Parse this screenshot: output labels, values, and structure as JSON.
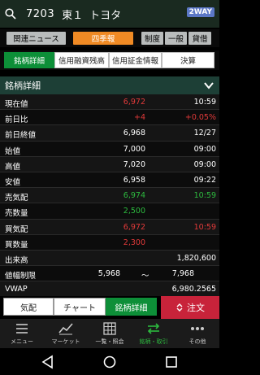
{
  "header": {
    "code": "7203",
    "market": "東１",
    "name": "トヨタ",
    "badge": "2WAY"
  },
  "top_buttons": {
    "news": "関連ニュース",
    "shikiho": "四季報",
    "seido": "制度",
    "ippan": "一般",
    "kashikabu": "貸借"
  },
  "tabs": {
    "detail": "銘柄詳細",
    "margin_balance": "信用融資残高",
    "margin_info": "信用証金情報",
    "settlement": "決算"
  },
  "section": {
    "title": "銘柄詳細"
  },
  "rows": [
    {
      "label": "現在値",
      "value": "6,972",
      "time": "10:59"
    },
    {
      "label": "前日比",
      "value": "+4",
      "time": "+0.05%"
    },
    {
      "label": "前日終値",
      "value": "6,968",
      "time": "12/27"
    },
    {
      "label": "始値",
      "value": "7,000",
      "time": "09:00"
    },
    {
      "label": "高値",
      "value": "7,020",
      "time": "09:00"
    },
    {
      "label": "安値",
      "value": "6,958",
      "time": "09:22"
    },
    {
      "label": "売気配",
      "value": "6,974",
      "time": "10:59"
    },
    {
      "label": "売数量",
      "value": "2,500",
      "time": ""
    },
    {
      "label": "買気配",
      "value": "6,972",
      "time": "10:59"
    },
    {
      "label": "買数量",
      "value": "2,300",
      "time": ""
    },
    {
      "label": "出来高",
      "value": "",
      "time": "1,820,600"
    },
    {
      "label": "値幅制限",
      "value": "5,968",
      "mid": "〜",
      "time": "7,968"
    },
    {
      "label": "VWAP",
      "value": "",
      "time": "6,980.2565"
    }
  ],
  "bottom_tabs": {
    "kehai": "気配",
    "chart": "チャート",
    "detail": "銘柄詳細",
    "order": "注文"
  },
  "nav": {
    "menu": "メニュー",
    "market": "マーケット",
    "list": "一覧・照会",
    "trade": "銘柄・取引",
    "other": "その他"
  }
}
